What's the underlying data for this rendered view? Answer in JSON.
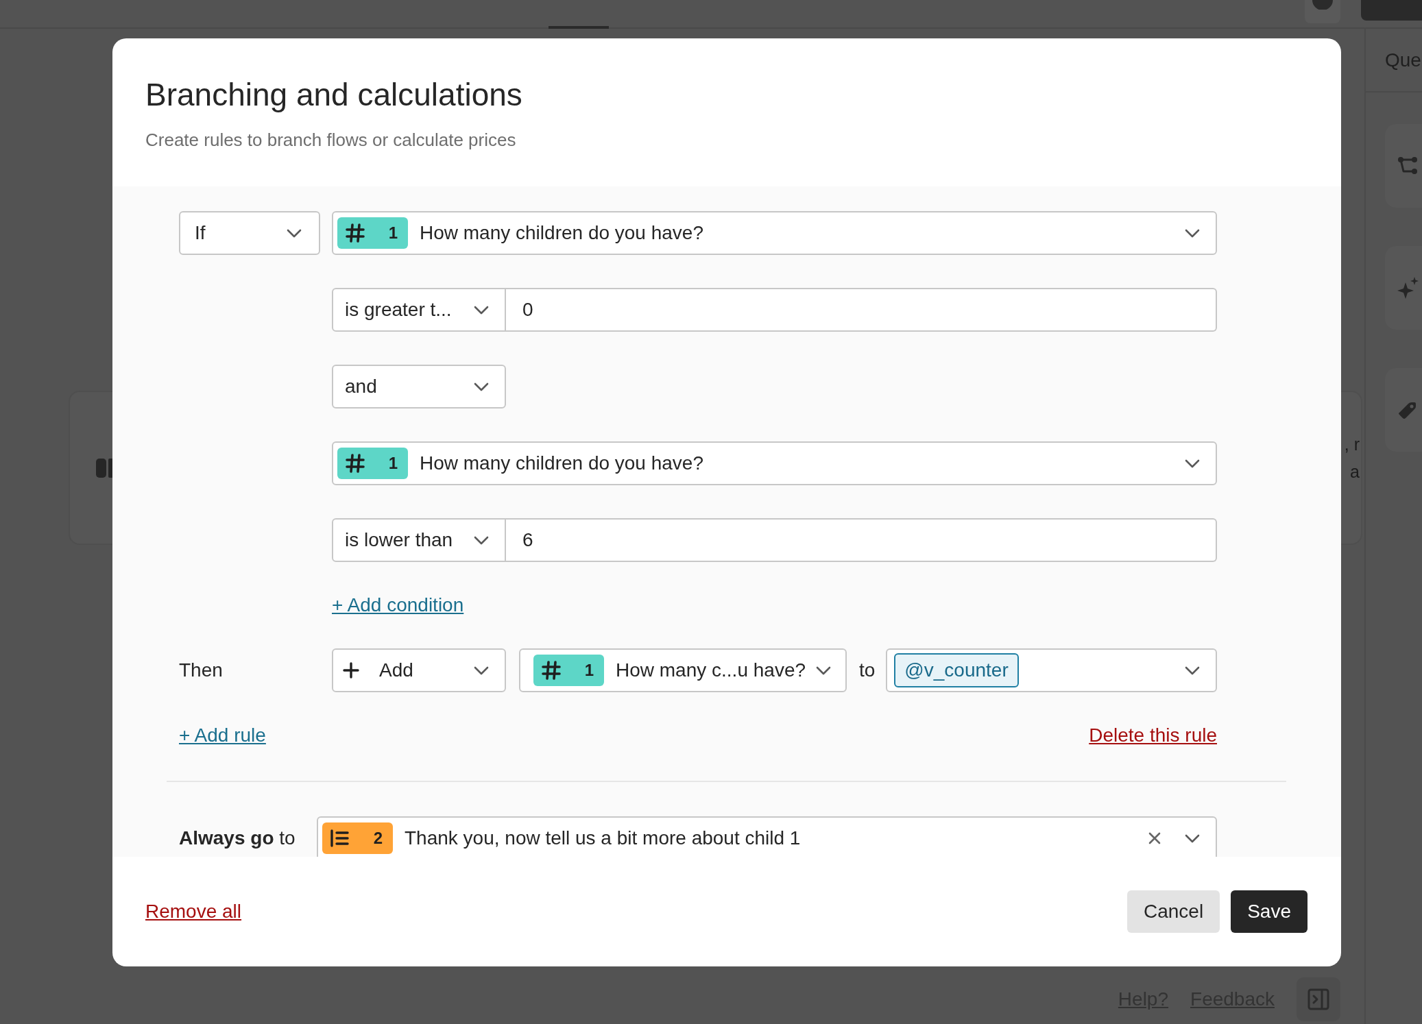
{
  "background": {
    "right_panel": {
      "title": "Que",
      "cards": [
        {
          "kind": "flow"
        },
        {
          "kind": "sparkle"
        },
        {
          "kind": "tag"
        }
      ]
    },
    "canvas_card": {
      "lines": [
        ", r",
        "a"
      ]
    },
    "footer_links": [
      "Help?",
      "Feedback"
    ]
  },
  "modal": {
    "title": "Branching and calculations",
    "subtitle": "Create rules to branch flows or calculate prices",
    "rule": {
      "start": {
        "operator": "If",
        "question": {
          "kind": "number",
          "number": "1",
          "text": "How many children do you have?"
        }
      },
      "conditions": [
        {
          "kind": "comparison",
          "operator": "is greater t...",
          "value": "0"
        },
        {
          "kind": "joiner",
          "operator": "and"
        },
        {
          "kind": "question",
          "question": {
            "kind": "number",
            "number": "1",
            "text": "How many children do you have?"
          }
        },
        {
          "kind": "comparison",
          "operator": "is lower than",
          "value": "6"
        }
      ],
      "add_condition": "+ Add condition",
      "then": {
        "label": "Then",
        "action": {
          "kind": "add",
          "label": "Add"
        },
        "question": {
          "kind": "number",
          "number": "1",
          "text": "How many c...u have?"
        },
        "connector": "to",
        "variable": "@v_counter"
      },
      "add_rule": "+ Add rule",
      "delete_rule": "Delete this rule"
    },
    "always_go_to": {
      "label": "**Always go** to",
      "target": {
        "kind": "statement",
        "number": "2",
        "text": "Thank you, now tell us a bit more about child 1"
      }
    },
    "remove_all": "Remove all",
    "buttons": [
      {
        "kind": "secondary",
        "label": "Cancel"
      },
      {
        "kind": "primary",
        "label": "Save"
      }
    ]
  }
}
